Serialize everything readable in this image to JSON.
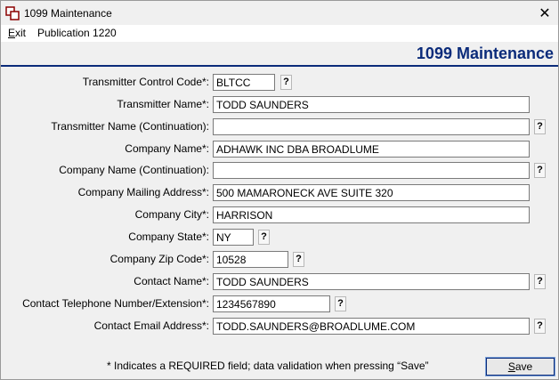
{
  "window": {
    "title": "1099 Maintenance",
    "close_glyph": "✕"
  },
  "menu": [
    {
      "label_accel": "E",
      "label_rest": "xit"
    },
    {
      "label": "Publication 1220"
    }
  ],
  "header": {
    "title": "1099 Maintenance"
  },
  "help_glyph": "?",
  "form": {
    "transmitter_control_code": {
      "label": "Transmitter Control Code*:",
      "value": "BLTCC"
    },
    "transmitter_name": {
      "label": "Transmitter Name*:",
      "value": "TODD SAUNDERS"
    },
    "transmitter_name_cont": {
      "label": "Transmitter Name (Continuation):",
      "value": ""
    },
    "company_name": {
      "label": "Company Name*:",
      "value": "ADHAWK INC DBA BROADLUME"
    },
    "company_name_cont": {
      "label": "Company Name (Continuation):",
      "value": ""
    },
    "company_address": {
      "label": "Company Mailing Address*:",
      "value": "500 MAMARONECK AVE SUITE 320"
    },
    "company_city": {
      "label": "Company City*:",
      "value": "HARRISON"
    },
    "company_state": {
      "label": "Company State*:",
      "value": "NY"
    },
    "company_zip": {
      "label": "Company Zip Code*:",
      "value": "10528"
    },
    "contact_name": {
      "label": "Contact Name*:",
      "value": "TODD SAUNDERS"
    },
    "contact_phone": {
      "label": "Contact Telephone Number/Extension*:",
      "value": "1234567890"
    },
    "contact_email": {
      "label": "Contact Email Address*:",
      "value": "TODD.SAUNDERS@BROADLUME.COM"
    }
  },
  "footnote": "* Indicates a REQUIRED field; data validation when pressing “Save”",
  "save_button": {
    "accel": "S",
    "rest": "ave"
  },
  "colors": {
    "header_blue": "#0b2b7a",
    "window_bg": "#f0f0f0"
  }
}
